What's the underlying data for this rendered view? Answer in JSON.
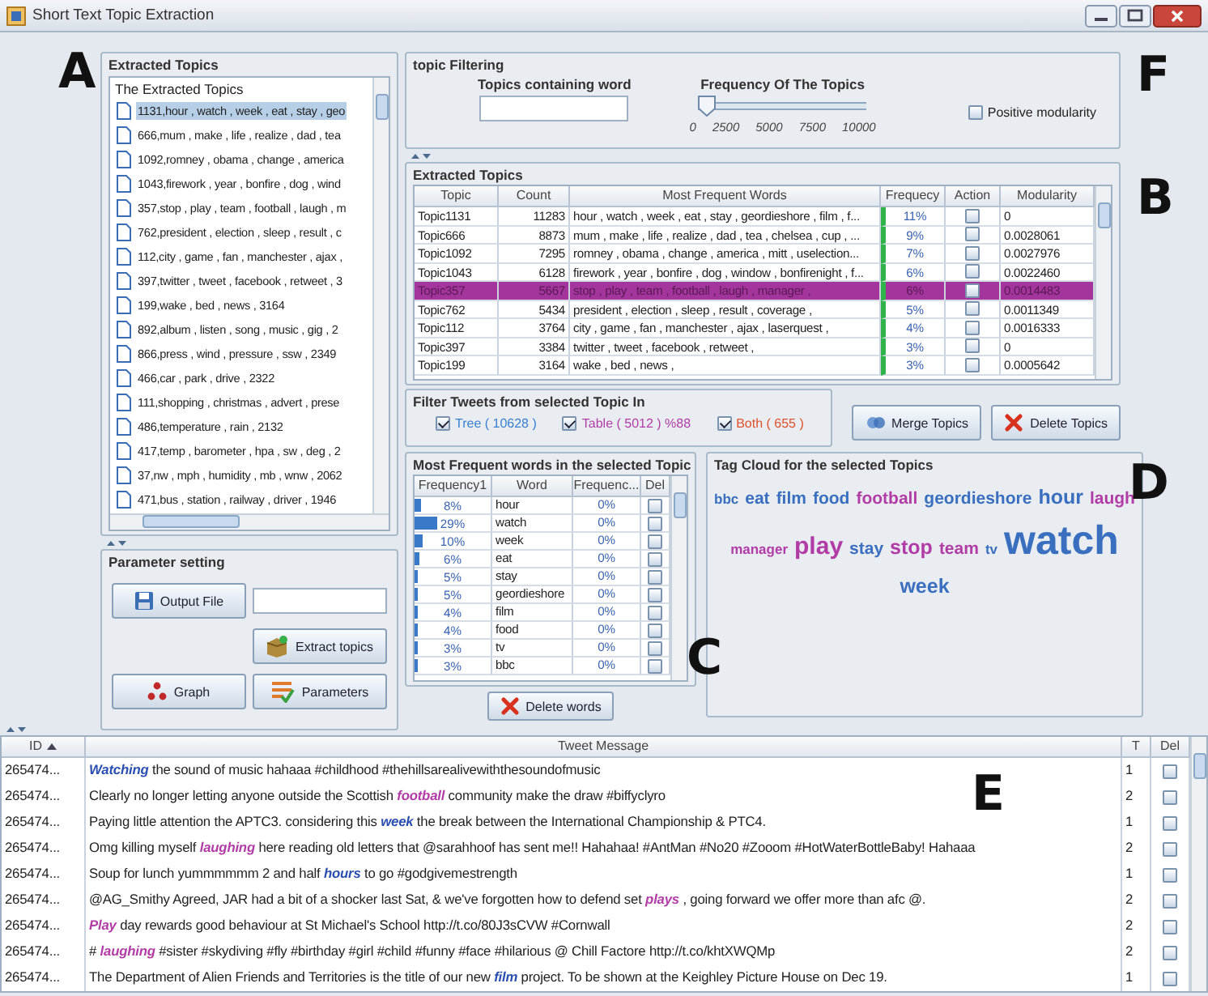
{
  "window": {
    "title": "Short Text Topic Extraction"
  },
  "callouts": [
    {
      "label": "A"
    },
    {
      "label": "F"
    },
    {
      "label": "B"
    },
    {
      "label": "D"
    },
    {
      "label": "C"
    },
    {
      "label": "E"
    }
  ],
  "topic_list": {
    "title": "Extracted Topics",
    "root": "The Extracted Topics",
    "items": [
      {
        "text": "1131,hour , watch , week , eat , stay , geo",
        "selected": true
      },
      {
        "text": "666,mum , make , life , realize , dad , tea",
        "selected": false
      },
      {
        "text": "1092,romney , obama , change , america",
        "selected": false
      },
      {
        "text": "1043,firework , year , bonfire , dog , wind",
        "selected": false
      },
      {
        "text": "357,stop , play , team , football , laugh , m",
        "selected": false
      },
      {
        "text": "762,president , election , sleep , result , c",
        "selected": false
      },
      {
        "text": "112,city , game , fan , manchester , ajax ,",
        "selected": false
      },
      {
        "text": "397,twitter , tweet , facebook , retweet , 3",
        "selected": false
      },
      {
        "text": "199,wake , bed , news , 3164",
        "selected": false
      },
      {
        "text": "892,album , listen , song , music , gig , 2",
        "selected": false
      },
      {
        "text": "866,press , wind , pressure , ssw , 2349",
        "selected": false
      },
      {
        "text": "466,car , park , drive , 2322",
        "selected": false
      },
      {
        "text": "111,shopping , christmas , advert , prese",
        "selected": false
      },
      {
        "text": "486,temperature , rain , 2132",
        "selected": false
      },
      {
        "text": "417,temp , barometer , hpa , sw , deg , 2",
        "selected": false
      },
      {
        "text": "37,nw , mph , humidity , mb , wnw , 2062",
        "selected": false
      },
      {
        "text": "471,bus , station , railway , driver , 1946",
        "selected": false
      }
    ]
  },
  "parameters": {
    "title": "Parameter setting",
    "buttons": [
      {
        "label": "Output File",
        "kind": "save"
      },
      {
        "label": "Extract topics",
        "kind": "extract"
      },
      {
        "label": "Graph",
        "kind": "graph"
      },
      {
        "label": "Parameters",
        "kind": "params"
      }
    ]
  },
  "topic_filtering": {
    "title": "topic Filtering",
    "word_label": "Topics containing word",
    "slider": {
      "label": "Frequency Of The Topics",
      "level": 0,
      "ticks": [
        "0",
        "2500",
        "5000",
        "7500",
        "10000"
      ]
    },
    "positive_modularity": {
      "label": "Positive modularity",
      "checked": false
    }
  },
  "topics_table": {
    "title": "Extracted Topics",
    "columns": [
      "Topic",
      "Count",
      "Most Frequent Words",
      "Frequecy",
      "Action",
      "Modularity"
    ],
    "rows": [
      {
        "topic": "Topic1131",
        "count": "11283",
        "words": "hour , watch , week , eat , stay , geordieshore , film , f...",
        "frequency": "11%",
        "action_checked": false,
        "modularity": "0",
        "selected": false
      },
      {
        "topic": "Topic666",
        "count": "8873",
        "words": "mum , make , life , realize , dad , tea , chelsea , cup , ...",
        "frequency": "9%",
        "action_checked": false,
        "modularity": "0.0028061",
        "selected": false
      },
      {
        "topic": "Topic1092",
        "count": "7295",
        "words": "romney , obama , change , america , mitt , uselection...",
        "frequency": "7%",
        "action_checked": false,
        "modularity": "0.0027976",
        "selected": false
      },
      {
        "topic": "Topic1043",
        "count": "6128",
        "words": "firework , year , bonfire , dog , window , bonfirenight , f...",
        "frequency": "6%",
        "action_checked": false,
        "modularity": "0.0022460",
        "selected": false
      },
      {
        "topic": "Topic357",
        "count": "5667",
        "words": "stop , play , team , football , laugh , manager ,",
        "frequency": "6%",
        "action_checked": false,
        "modularity": "0.0014483",
        "selected": true
      },
      {
        "topic": "Topic762",
        "count": "5434",
        "words": "president , election , sleep , result , coverage ,",
        "frequency": "5%",
        "action_checked": false,
        "modularity": "0.0011349",
        "selected": false
      },
      {
        "topic": "Topic112",
        "count": "3764",
        "words": "city , game , fan , manchester , ajax , laserquest ,",
        "frequency": "4%",
        "action_checked": false,
        "modularity": "0.0016333",
        "selected": false
      },
      {
        "topic": "Topic397",
        "count": "3384",
        "words": "twitter , tweet , facebook , retweet ,",
        "frequency": "3%",
        "action_checked": false,
        "modularity": "0",
        "selected": false
      },
      {
        "topic": "Topic199",
        "count": "3164",
        "words": "wake , bed , news ,",
        "frequency": "3%",
        "action_checked": false,
        "modularity": "0.0005642",
        "selected": false
      }
    ]
  },
  "tweet_filter": {
    "title": "Filter Tweets from selected Topic In",
    "options": [
      {
        "label": "Tree ( 10628 )",
        "checked": true,
        "color": "#3a7fd0"
      },
      {
        "label": "Table ( 5012 ) %88",
        "checked": true,
        "color": "#b23ca6"
      },
      {
        "label": "Both ( 655 )",
        "checked": true,
        "color": "#e0502a"
      }
    ]
  },
  "topic_buttons": [
    {
      "label": "Merge Topics",
      "kind": "merge"
    },
    {
      "label": "Delete Topics",
      "kind": "delete"
    }
  ],
  "words_table": {
    "title": "Most Frequent words in the selected Topic",
    "columns": [
      "Frequency1",
      "Word",
      "Frequenc...",
      "Del"
    ],
    "rows": [
      {
        "frequency": "8%",
        "level": 0.08,
        "word": "hour",
        "frequency_2": "0%",
        "del_checked": false
      },
      {
        "frequency": "29%",
        "level": 0.29,
        "word": "watch",
        "frequency_2": "0%",
        "del_checked": false
      },
      {
        "frequency": "10%",
        "level": 0.1,
        "word": "week",
        "frequency_2": "0%",
        "del_checked": false
      },
      {
        "frequency": "6%",
        "level": 0.06,
        "word": "eat",
        "frequency_2": "0%",
        "del_checked": false
      },
      {
        "frequency": "5%",
        "level": 0.05,
        "word": "stay",
        "frequency_2": "0%",
        "del_checked": false
      },
      {
        "frequency": "5%",
        "level": 0.05,
        "word": "geordieshore",
        "frequency_2": "0%",
        "del_checked": false
      },
      {
        "frequency": "4%",
        "level": 0.04,
        "word": "film",
        "frequency_2": "0%",
        "del_checked": false
      },
      {
        "frequency": "4%",
        "level": 0.04,
        "word": "food",
        "frequency_2": "0%",
        "del_checked": false
      },
      {
        "frequency": "3%",
        "level": 0.03,
        "word": "tv",
        "frequency_2": "0%",
        "del_checked": false
      },
      {
        "frequency": "3%",
        "level": 0.03,
        "word": "bbc",
        "frequency_2": "0%",
        "del_checked": false
      }
    ],
    "button": {
      "label": "Delete words",
      "kind": "delete"
    }
  },
  "tag_cloud": {
    "title": "Tag Cloud for the selected Topics",
    "lines": [
      {
        "words": [
          {
            "text": "bbc",
            "kind": "small",
            "color": "#3a6fc0"
          },
          {
            "text": "eat",
            "kind": "medium",
            "color": "#3a6fc0"
          },
          {
            "text": "film",
            "kind": "medium",
            "color": "#3a6fc0"
          },
          {
            "text": "food",
            "kind": "medium",
            "color": "#3a6fc0"
          },
          {
            "text": "football",
            "kind": "medium",
            "color": "#b23ca6"
          },
          {
            "text": "geordieshore",
            "kind": "medium",
            "color": "#3a6fc0"
          },
          {
            "text": "hour",
            "kind": "large",
            "color": "#3a6fc0"
          },
          {
            "text": "laugh",
            "kind": "medium",
            "color": "#b23ca6"
          }
        ]
      },
      {
        "words": [
          {
            "text": "manager",
            "kind": "small",
            "color": "#b23ca6"
          },
          {
            "text": "play",
            "kind": "xlarge",
            "color": "#b23ca6"
          },
          {
            "text": "stay",
            "kind": "medium",
            "color": "#3a6fc0"
          },
          {
            "text": "stop",
            "kind": "large",
            "color": "#b23ca6"
          },
          {
            "text": "team",
            "kind": "medium",
            "color": "#b23ca6"
          },
          {
            "text": "tv",
            "kind": "small",
            "color": "#3a6fc0"
          },
          {
            "text": "watch",
            "kind": "huge",
            "color": "#3a6fc0"
          }
        ]
      },
      {
        "words": [
          {
            "text": "week",
            "kind": "large",
            "color": "#3a6fc0"
          }
        ]
      }
    ]
  },
  "tweets": {
    "columns": [
      "ID",
      "Tweet Message",
      "T",
      "Del"
    ],
    "rows": [
      {
        "id": "265474...",
        "message": "**Watching** the sound of music hahaaa #childhood #thehillsarealivewiththesoundofmusic",
        "color": "#2a4fb0",
        "t": "1",
        "del_checked": false
      },
      {
        "id": "265474...",
        "message": "Clearly no longer letting anyone outside the Scottish **football** community make the draw #biffyclyro",
        "color": "#b23ca6",
        "t": "2",
        "del_checked": false
      },
      {
        "id": "265474...",
        "message": "Paying little attention the APTC3. considering this **week** the break between the International Championship & PTC4.",
        "color": "#2a4fb0",
        "t": "1",
        "del_checked": false
      },
      {
        "id": "265474...",
        "message": "Omg killing myself **laughing** here reading old letters that @sarahhoof has sent me!! Hahahaa! #AntMan #No20 #Zooom #HotWaterBottleBaby! Hahaaa",
        "color": "#b23ca6",
        "t": "2",
        "del_checked": false
      },
      {
        "id": "265474...",
        "message": "Soup for lunch yummmmmm 2 and half **hours** to go #godgivemestrength",
        "color": "#2a4fb0",
        "t": "1",
        "del_checked": false
      },
      {
        "id": "265474...",
        "message": "@AG_Smithy Agreed, JAR had a bit of a shocker last Sat, & we've forgotten how to defend set **plays** , going forward we offer more than afc @.",
        "color": "#b23ca6",
        "t": "2",
        "del_checked": false
      },
      {
        "id": "265474...",
        "message": "**Play** day rewards good behaviour at St Michael's School http://t.co/80J3sCVW #Cornwall",
        "color": "#b23ca6",
        "t": "2",
        "del_checked": false
      },
      {
        "id": "265474...",
        "message": "# **laughing** #sister #skydiving #fly #birthday #girl #child #funny #face #hilarious @ Chill Factore http://t.co/khtXWQMp",
        "color": "#b23ca6",
        "t": "2",
        "del_checked": false
      },
      {
        "id": "265474...",
        "message": "The Department of Alien Friends and Territories is the title of our new **film** project. To be shown at the Keighley Picture House on Dec 19.",
        "color": "#2a4fb0",
        "t": "1",
        "del_checked": false
      }
    ]
  }
}
